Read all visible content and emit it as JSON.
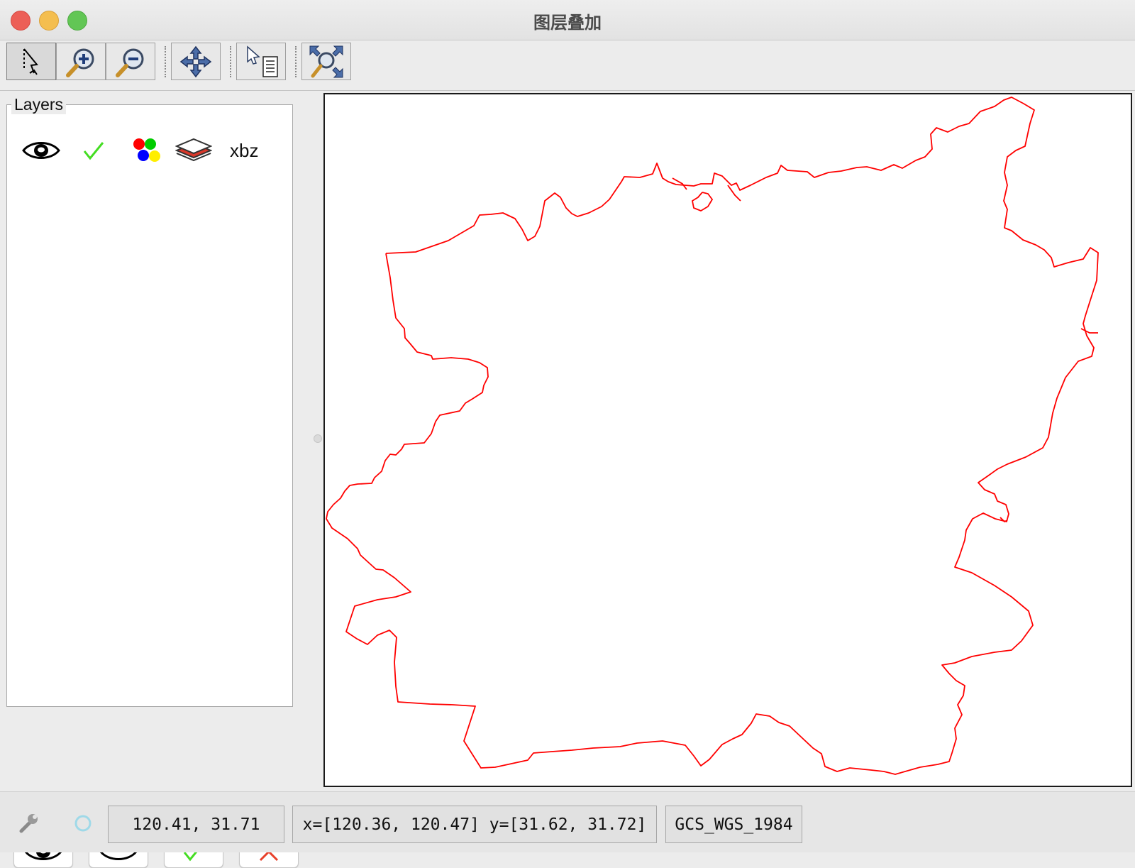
{
  "window": {
    "title": "图层叠加"
  },
  "toolbar": {
    "buttons": [
      {
        "icon": "select-arrow-icon"
      },
      {
        "icon": "zoom-in-icon"
      },
      {
        "icon": "zoom-out-icon"
      },
      {
        "icon": "pan-icon"
      },
      {
        "icon": "info-identify-icon"
      },
      {
        "icon": "zoom-to-extent-icon"
      }
    ]
  },
  "layers_panel": {
    "title": "Layers",
    "layers": [
      {
        "name": "xbz",
        "visible": true,
        "selected": true,
        "style_icon": "color-palette-icon",
        "type_icon": "layer-stack-icon",
        "stroke_color": "#ff0000"
      }
    ],
    "buttons": [
      {
        "icon": "eye-open-icon"
      },
      {
        "icon": "eye-closed-icon"
      },
      {
        "icon": "checkmark-icon"
      },
      {
        "icon": "cross-icon"
      }
    ]
  },
  "statusbar": {
    "coordinates": "120.41, 31.71",
    "extent": "x=[120.36, 120.47]  y=[31.62, 31.72]",
    "crs": "GCS_WGS_1984"
  },
  "colors": {
    "feature_outline": "#ff0000",
    "check_green": "#44dd22",
    "cross_red": "#e8402a"
  }
}
